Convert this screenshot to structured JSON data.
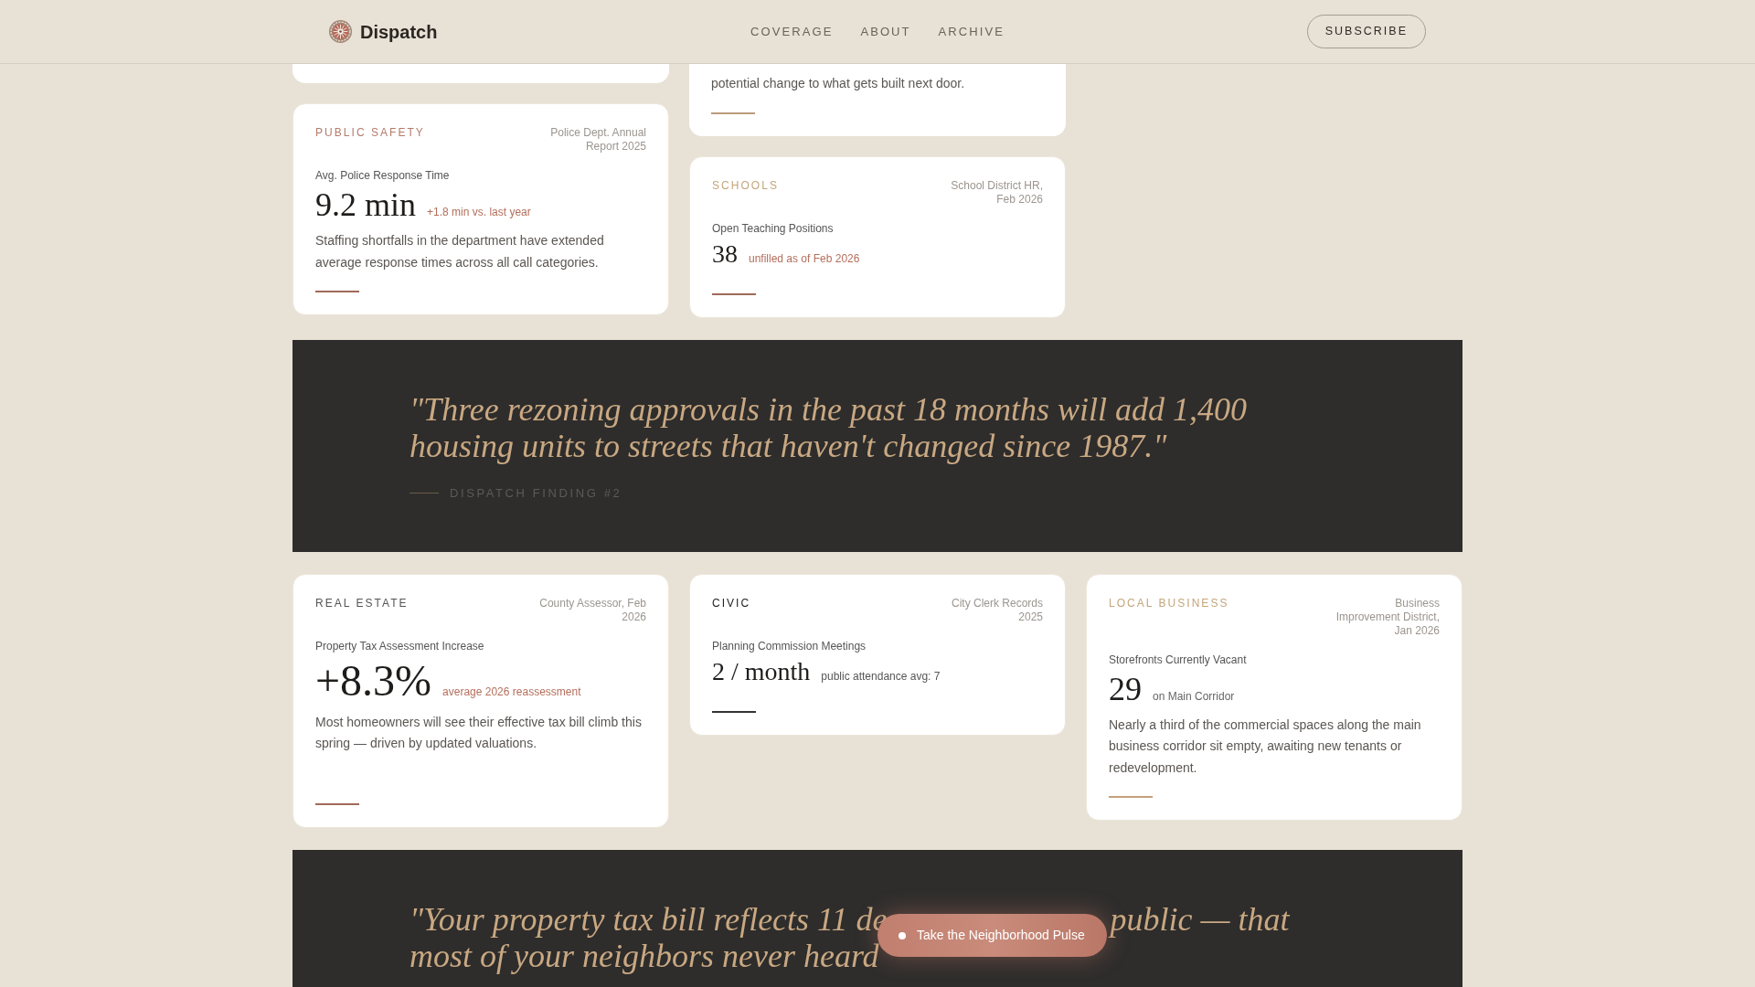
{
  "header": {
    "logo": "Dispatch",
    "nav": [
      {
        "label": "COVERAGE"
      },
      {
        "label": "ABOUT"
      },
      {
        "label": "ARCHIVE"
      }
    ],
    "subscribe": "SUBSCRIBE"
  },
  "sections": [
    {
      "kind": "columns",
      "columns": [
        [
          {
            "kind": "cut_off"
          },
          {
            "kind": "full",
            "category": "PUBLIC SAFETY",
            "color": "#b47b6b",
            "source": "Police Dept. Annual Report 2025",
            "metric": "Avg. Police Response Time",
            "value": "9.2 min",
            "note": {
              "text": "+1.8 min vs. last year",
              "color": "#b46e5c"
            },
            "description": "Staffing shortfalls in the department have extended average response times across all call categories.",
            "rule": {
              "color": "#a06a58"
            }
          }
        ],
        [
          {
            "kind": "cut_off",
            "description": "potential change to what gets built next door.",
            "rule": {
              "color": "#bb9d7b"
            }
          },
          {
            "kind": "full",
            "category": "SCHOOLS",
            "color": "#c4a57b",
            "source": "School District HR, Feb 2026",
            "metric": "Open Teaching Positions",
            "value": "38",
            "note": {
              "text": "unfilled as of Feb 2026",
              "color": "#b46e5c"
            },
            "rule": {
              "color": "#a06a58"
            }
          }
        ]
      ]
    },
    {
      "kind": "quote",
      "parts": [
        "\"Three rezoning approvals in the past 18 months will add 1,400 housing units to streets that haven't changed since 1987.\""
      ],
      "attribution": "DISPATCH FINDING #2"
    },
    {
      "kind": "cards",
      "cards": [
        {
          "kind": "full",
          "category": "REAL ESTATE",
          "color": "#555555",
          "source": "County Assessor, Feb 2026",
          "metric": "Property Tax Assessment Increase",
          "value": "+8.3%",
          "note": {
            "text": "average 2026 reassessment",
            "color": "#b46e5c"
          },
          "description": "Most homeowners will see their effective tax bill climb this spring — driven by updated valuations.",
          "rule": {
            "color": "#a06a58"
          }
        },
        {
          "kind": "full",
          "category": "CIVIC",
          "color": "#222222",
          "source": "City Clerk Records 2025",
          "metric": "Planning Commission Meetings",
          "value": "2 / month",
          "note": {
            "text": "public attendance avg: 7",
            "color": "#555555"
          },
          "rule": {
            "color": "#333333"
          }
        },
        {
          "kind": "full",
          "category": "LOCAL BUSINESS",
          "color": "#c4a57b",
          "source": "Business Improvement District, Jan 2026",
          "metric": "Storefronts Currently Vacant",
          "value": "29",
          "note": {
            "text": "on Main Corridor",
            "color": "#666666"
          },
          "description": "Nearly a third of the commercial spaces along the main business corridor sit empty, awaiting new tenants or redevelopment.",
          "rule": {
            "color": "#c4a07a"
          }
        }
      ]
    },
    {
      "kind": "quote",
      "parts": [
        "\"Your property tax bill reflects 11 de",
        "public — that",
        "most of your neighbors never heard"
      ]
    }
  ],
  "floating_button": {
    "label": "Take the Neighborhood Pulse"
  }
}
